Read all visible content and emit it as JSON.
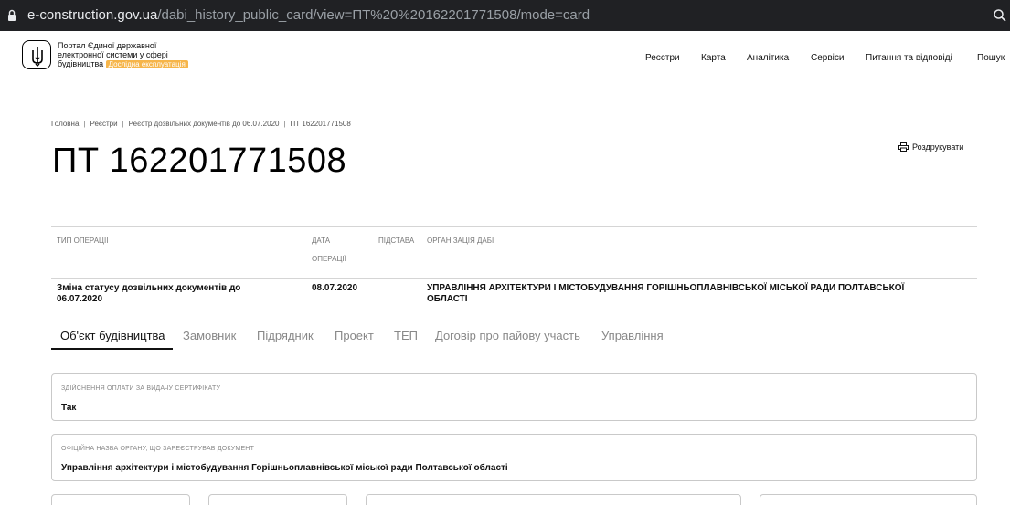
{
  "browser": {
    "url_host": "e-construction.gov.ua",
    "url_path": "/dabi_history_public_card/view=ПТ%20%20162201771508/mode=card"
  },
  "header": {
    "brand_line1": "Портал Єдиної державної",
    "brand_line2": "електронної системи у сфері",
    "brand_line3": "будівництва",
    "beta_label": "Дослідна експлуатація",
    "nav": [
      "Реєстри",
      "Карта",
      "Аналітика",
      "Сервіси",
      "Питання та відповіді",
      "Пошук"
    ]
  },
  "breadcrumb": [
    "Головна",
    "Реєстри",
    "Реєстр дозвільних документів до 06.07.2020",
    "ПТ 162201771508"
  ],
  "page_title": "ПТ 162201771508",
  "print_label": "Роздрукувати",
  "operations": {
    "headers": {
      "type": "ТИП ОПЕРАЦІЇ",
      "date_line1": "ДАТА",
      "date_line2": "ОПЕРАЦІЇ",
      "basis": "ПІДСТАВА",
      "org": "ОРГАНІЗАЦІЯ ДАБІ"
    },
    "row": {
      "type_line1": "Зміна статусу дозвільних документів до",
      "type_line2": "06.07.2020",
      "date": "08.07.2020",
      "basis": "",
      "org_line1": "УПРАВЛІННЯ АРХІТЕКТУРИ І МІСТОБУДУВАННЯ ГОРІШНЬОПЛАВНІВСЬКОЇ МІСЬКОЇ РАДИ ПОЛТАВСЬКОЇ",
      "org_line2": "ОБЛАСТІ"
    }
  },
  "tabs": [
    "Об'єкт будівництва",
    "Замовник",
    "Підрядник",
    "Проект",
    "ТЕП",
    "Договір про пайову участь",
    "Управління"
  ],
  "fields": [
    {
      "label": "ЗДІЙСНЕННЯ ОПЛАТИ ЗА ВИДАЧУ СЕРТИФІКАТУ",
      "value": "Так"
    },
    {
      "label": "ОФІЦІЙНА НАЗВА ОРГАНУ, ЩО ЗАРЕЄСТРУВАВ ДОКУМЕНТ",
      "value": "Управління архітектури і містобудування Горішньоплавнівської міської ради Полтавської області"
    }
  ]
}
